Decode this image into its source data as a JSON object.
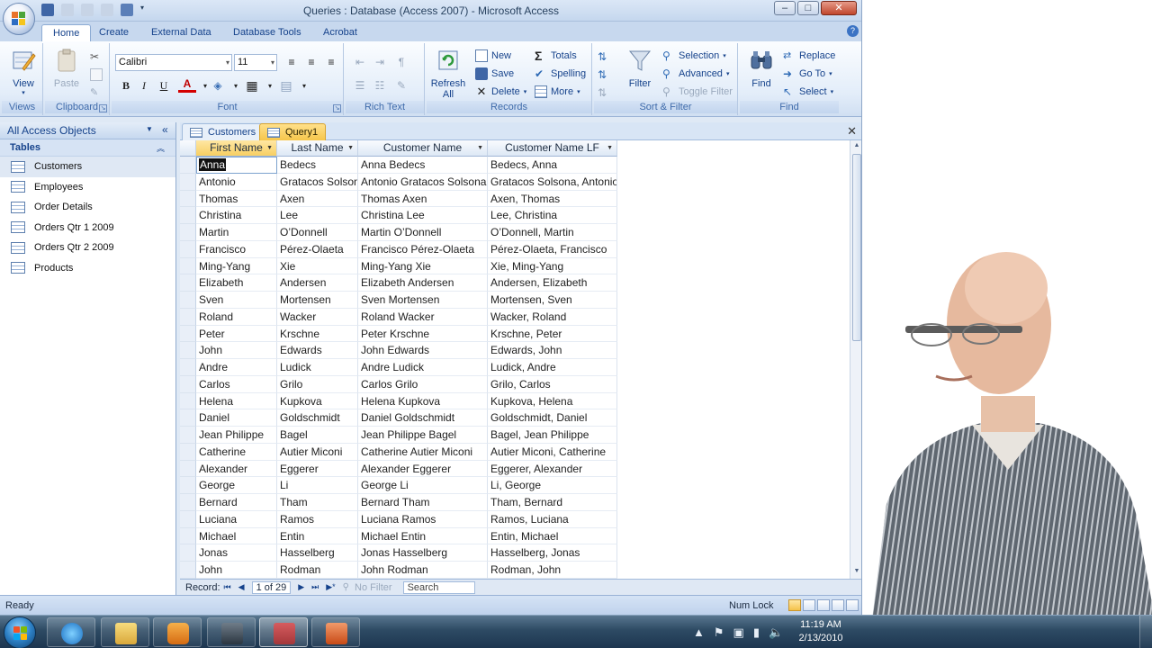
{
  "window": {
    "title": "Queries : Database (Access 2007) - Microsoft Access",
    "controls": {
      "minimize": "–",
      "maximize": "□",
      "close": "✕"
    }
  },
  "ribbon": {
    "tabs": [
      "Home",
      "Create",
      "External Data",
      "Database Tools",
      "Acrobat"
    ],
    "active_tab": "Home",
    "help": "?",
    "groups": {
      "views": {
        "label": "Views",
        "view": "View"
      },
      "clipboard": {
        "label": "Clipboard",
        "paste": "Paste"
      },
      "font": {
        "label": "Font",
        "font_name": "Calibri",
        "font_size": "11",
        "bold": "B",
        "italic": "I",
        "underline": "U",
        "font_color": "A"
      },
      "rich_text": {
        "label": "Rich Text"
      },
      "records": {
        "label": "Records",
        "refresh": "Refresh All",
        "new": "New",
        "save": "Save",
        "delete": "Delete",
        "totals": "Totals",
        "spelling": "Spelling",
        "more": "More"
      },
      "sort_filter": {
        "label": "Sort & Filter",
        "filter": "Filter",
        "selection": "Selection",
        "advanced": "Advanced",
        "toggle_filter": "Toggle Filter"
      },
      "find": {
        "label": "Find",
        "find": "Find",
        "replace": "Replace",
        "goto": "Go To",
        "select": "Select"
      }
    }
  },
  "nav": {
    "title": "All Access Objects",
    "group": "Tables",
    "items": [
      "Customers",
      "Employees",
      "Order Details",
      "Orders Qtr 1 2009",
      "Orders Qtr 2 2009",
      "Products"
    ],
    "selected": "Customers"
  },
  "doc_tabs": [
    {
      "label": "Customers",
      "active": false
    },
    {
      "label": "Query1",
      "active": true
    }
  ],
  "close_doc": "✕",
  "datasheet": {
    "columns": [
      "First Name",
      "Last Name",
      "Customer Name",
      "Customer Name LF"
    ],
    "rows": [
      [
        "Anna",
        "Bedecs",
        "Anna Bedecs",
        "Bedecs, Anna"
      ],
      [
        "Antonio",
        "Gratacos Solsona",
        "Antonio Gratacos Solsona",
        "Gratacos Solsona, Antonio"
      ],
      [
        "Thomas",
        "Axen",
        "Thomas Axen",
        "Axen, Thomas"
      ],
      [
        "Christina",
        "Lee",
        "Christina Lee",
        "Lee, Christina"
      ],
      [
        "Martin",
        "O’Donnell",
        "Martin O’Donnell",
        "O’Donnell, Martin"
      ],
      [
        "Francisco",
        "Pérez-Olaeta",
        "Francisco Pérez-Olaeta",
        "Pérez-Olaeta, Francisco"
      ],
      [
        "Ming-Yang",
        "Xie",
        "Ming-Yang Xie",
        "Xie, Ming-Yang"
      ],
      [
        "Elizabeth",
        "Andersen",
        "Elizabeth Andersen",
        "Andersen, Elizabeth"
      ],
      [
        "Sven",
        "Mortensen",
        "Sven Mortensen",
        "Mortensen, Sven"
      ],
      [
        "Roland",
        "Wacker",
        "Roland Wacker",
        "Wacker, Roland"
      ],
      [
        "Peter",
        "Krschne",
        "Peter Krschne",
        "Krschne, Peter"
      ],
      [
        "John",
        "Edwards",
        "John Edwards",
        "Edwards, John"
      ],
      [
        "Andre",
        "Ludick",
        "Andre Ludick",
        "Ludick, Andre"
      ],
      [
        "Carlos",
        "Grilo",
        "Carlos Grilo",
        "Grilo, Carlos"
      ],
      [
        "Helena",
        "Kupkova",
        "Helena Kupkova",
        "Kupkova, Helena"
      ],
      [
        "Daniel",
        "Goldschmidt",
        "Daniel Goldschmidt",
        "Goldschmidt, Daniel"
      ],
      [
        "Jean Philippe",
        "Bagel",
        "Jean Philippe Bagel",
        "Bagel, Jean Philippe"
      ],
      [
        "Catherine",
        "Autier Miconi",
        "Catherine Autier Miconi",
        "Autier Miconi, Catherine"
      ],
      [
        "Alexander",
        "Eggerer",
        "Alexander Eggerer",
        "Eggerer, Alexander"
      ],
      [
        "George",
        "Li",
        "George Li",
        "Li, George"
      ],
      [
        "Bernard",
        "Tham",
        "Bernard Tham",
        "Tham, Bernard"
      ],
      [
        "Luciana",
        "Ramos",
        "Luciana Ramos",
        "Ramos, Luciana"
      ],
      [
        "Michael",
        "Entin",
        "Michael Entin",
        "Entin, Michael"
      ],
      [
        "Jonas",
        "Hasselberg",
        "Jonas Hasselberg",
        "Hasselberg, Jonas"
      ],
      [
        "John",
        "Rodman",
        "John Rodman",
        "Rodman, John"
      ]
    ]
  },
  "record_nav": {
    "label": "Record:",
    "position": "1 of 29",
    "filter": "No Filter",
    "search_placeholder": "Search"
  },
  "status": {
    "left": "Ready",
    "num_lock": "Num Lock"
  },
  "taskbar": {
    "time": "11:19 AM",
    "date": "2/13/2010"
  },
  "colors": {
    "ribbon_text": "#15428b",
    "active_tab_gold": "#f6c64b",
    "access_red": "#a4373a"
  }
}
